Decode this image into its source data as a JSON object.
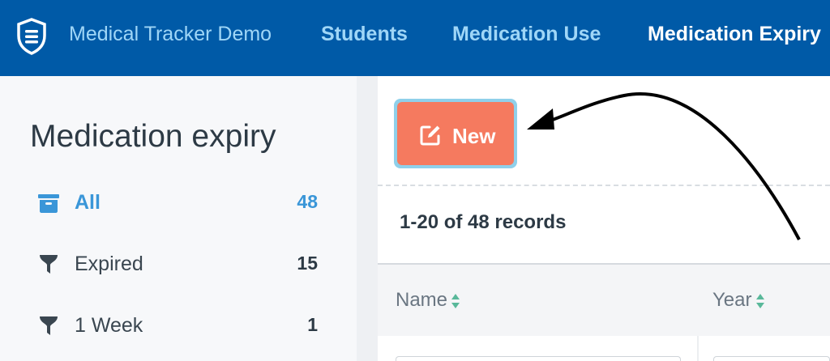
{
  "header": {
    "app_title": "Medical Tracker Demo",
    "logo_icon": "shield-list-icon",
    "nav": [
      {
        "label": "Students",
        "active": false
      },
      {
        "label": "Medication Use",
        "active": false
      },
      {
        "label": "Medication Expiry",
        "active": true
      }
    ],
    "bg_color": "#005aa7"
  },
  "sidebar": {
    "title": "Medication expiry",
    "items": [
      {
        "label": "All",
        "count": "48",
        "icon": "inbox-icon",
        "active": true
      },
      {
        "label": "Expired",
        "count": "15",
        "icon": "filter-icon",
        "active": false
      },
      {
        "label": "1 Week",
        "count": "1",
        "icon": "filter-icon",
        "active": false
      }
    ]
  },
  "main": {
    "new_button": {
      "label": "New",
      "icon": "edit-icon",
      "color": "#f57a5f",
      "highlight_color": "#8fd0ea"
    },
    "records_text": "1-20 of 48 records",
    "table": {
      "columns": [
        {
          "label": "Name",
          "sort_icon": "sort-icon"
        },
        {
          "label": "Year",
          "sort_icon": "sort-icon"
        }
      ]
    }
  },
  "colors": {
    "accent": "#3a96d8",
    "text_dark": "#2d3a45",
    "sort_icon": "#59b89a"
  }
}
